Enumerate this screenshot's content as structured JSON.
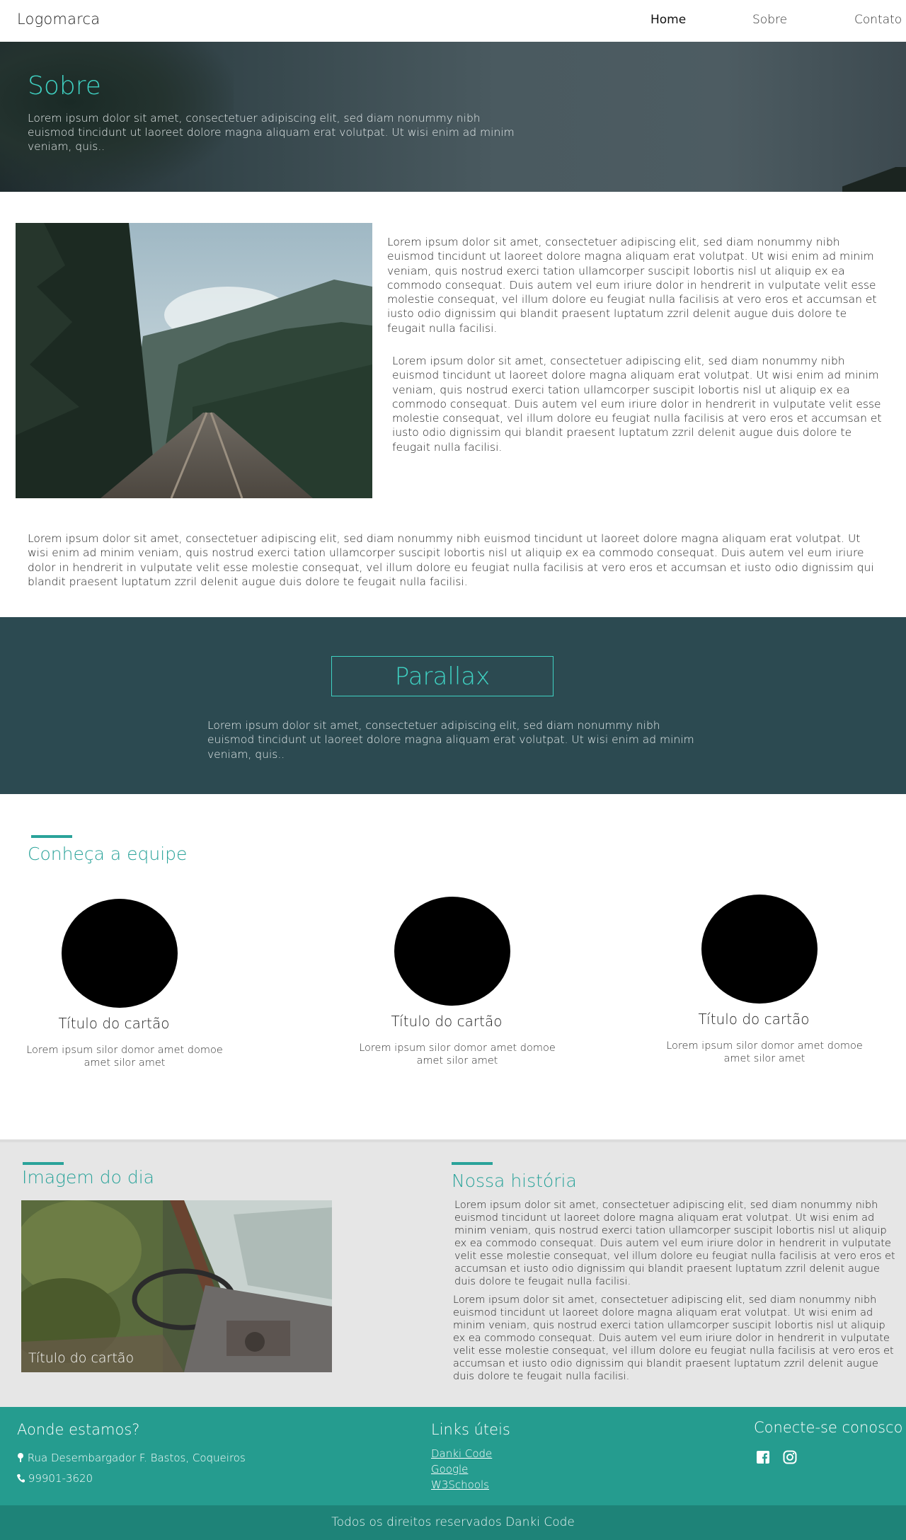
{
  "header": {
    "logo": "Logomarca",
    "nav": [
      "Home",
      "Sobre",
      "Contato"
    ]
  },
  "hero": {
    "title": "Sobre",
    "text": "Lorem ipsum dolor sit amet, consectetuer adipiscing elit, sed diam nonummy nibh euismod tincidunt ut laoreet dolore magna aliquam erat volutpat. Ut wisi enim ad minim veniam, quis.."
  },
  "about": {
    "p1": "Lorem ipsum dolor sit amet, consectetuer adipiscing elit, sed diam nonummy nibh euismod tincidunt ut laoreet dolore magna aliquam erat volutpat. Ut wisi enim ad minim veniam, quis nostrud exerci tation ullamcorper suscipit lobortis nisl ut aliquip ex ea commodo consequat. Duis autem vel eum iriure dolor in hendrerit in vulputate velit esse molestie consequat, vel illum dolore eu feugiat nulla facilisis at vero eros et accumsan et iusto odio dignissim qui blandit praesent luptatum zzril delenit augue duis dolore te feugait nulla facilisi.",
    "p2": "Lorem ipsum dolor sit amet, consectetuer adipiscing elit, sed diam nonummy nibh euismod tincidunt ut laoreet dolore magna aliquam erat volutpat. Ut wisi enim ad minim veniam, quis nostrud exerci tation ullamcorper suscipit lobortis nisl ut aliquip ex ea commodo consequat. Duis autem vel eum iriure dolor in hendrerit in vulputate velit esse molestie consequat, vel illum dolore eu feugiat nulla facilisis at vero eros et accumsan et iusto odio dignissim qui blandit praesent luptatum zzril delenit augue duis dolore te feugait nulla facilisi.",
    "p3": "Lorem ipsum dolor sit amet, consectetuer adipiscing elit, sed diam nonummy nibh euismod tincidunt ut laoreet dolore magna aliquam erat volutpat. Ut wisi enim ad minim veniam, quis nostrud exerci tation ullamcorper suscipit lobortis nisl ut aliquip ex ea commodo consequat. Duis autem vel eum iriure dolor in hendrerit in vulputate velit esse molestie consequat, vel illum dolore eu feugiat nulla facilisis at vero eros et accumsan et iusto odio dignissim qui blandit praesent luptatum zzril delenit augue duis dolore te feugait nulla facilisi."
  },
  "parallax": {
    "title": "Parallax",
    "text": "Lorem ipsum dolor sit amet, consectetuer adipiscing elit, sed diam nonummy nibh euismod tincidunt ut laoreet dolore magna aliquam erat volutpat. Ut wisi enim ad minim veniam, quis.."
  },
  "team": {
    "title": "Conheça a equipe",
    "cards": [
      {
        "title": "Título do cartão",
        "text": "Lorem ipsum silor domor amet domoe amet silor amet"
      },
      {
        "title": "Título do cartão",
        "text": "Lorem ipsum silor domor amet domoe amet silor amet"
      },
      {
        "title": "Título do cartão",
        "text": "Lorem ipsum silor domor amet domoe amet silor amet"
      }
    ]
  },
  "image_of_day": {
    "title": "Imagem do dia",
    "caption": "Título do cartão"
  },
  "history": {
    "title": "Nossa história",
    "p1": "Lorem ipsum dolor sit amet, consectetuer adipiscing elit, sed diam nonummy nibh euismod tincidunt ut laoreet dolore magna aliquam erat volutpat. Ut wisi enim ad minim veniam, quis nostrud exerci tation ullamcorper suscipit lobortis nisl ut aliquip ex ea commodo consequat. Duis autem vel eum iriure dolor in hendrerit in vulputate velit esse molestie consequat, vel illum dolore eu feugiat nulla facilisis at vero eros et accumsan et iusto odio dignissim qui blandit praesent luptatum zzril delenit augue duis dolore te feugait nulla facilisi.",
    "p2": "Lorem ipsum dolor sit amet, consectetuer adipiscing elit, sed diam nonummy nibh euismod tincidunt ut laoreet dolore magna aliquam erat volutpat. Ut wisi enim ad minim veniam, quis nostrud exerci tation ullamcorper suscipit lobortis nisl ut aliquip ex ea commodo consequat. Duis autem vel eum iriure dolor in hendrerit in vulputate velit esse molestie consequat, vel illum dolore eu feugiat nulla facilisis at vero eros et accumsan et iusto odio dignissim qui blandit praesent luptatum zzril delenit augue duis dolore te feugait nulla facilisi."
  },
  "footer": {
    "where_title": "Aonde estamos?",
    "address": "Rua Desembargador F. Bastos, Coqueiros",
    "phone": "99901-3620",
    "links_title": "Links úteis",
    "links": [
      "Danki Code",
      "Google",
      "W3Schools"
    ],
    "connect_title": "Conecte-se conosco",
    "social_icons": [
      "facebook-icon",
      "instagram-icon"
    ],
    "copyright": "Todos os direitos reservados Danki Code"
  },
  "colors": {
    "accent": "#3fd1c2",
    "teal": "#2aa39a",
    "parallax_bg": "#2c4a51",
    "footer_bg": "#259c8f",
    "bottom_bar": "#1e8378"
  }
}
